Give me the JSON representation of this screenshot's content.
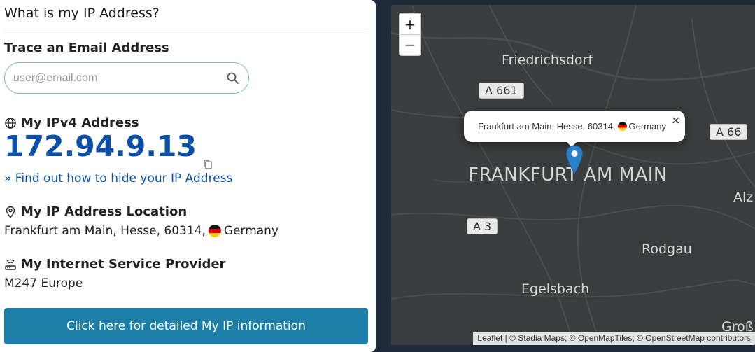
{
  "page": {
    "title": "What is my IP Address?"
  },
  "trace": {
    "heading": "Trace an Email Address",
    "placeholder": "user@email.com",
    "icon": "search-icon"
  },
  "ipv4": {
    "heading": "My IPv4 Address",
    "value": "172.94.9.13",
    "icon": "globe-icon",
    "hide_link": "» Find out how to hide your IP Address"
  },
  "location": {
    "heading": "My IP Address Location",
    "text": "Frankfurt am Main, Hesse, 60314,",
    "country": "Germany",
    "icon": "location-pin-icon"
  },
  "isp": {
    "heading": "My Internet Service Provider",
    "value": "M247 Europe",
    "icon": "router-icon"
  },
  "detail_button": {
    "label": "Click here for detailed My IP information"
  },
  "map": {
    "zoom_in": "+",
    "zoom_out": "−",
    "labels": {
      "friedrichsdorf": "Friedrichsdorf",
      "frankfurt": "FRANKFURT AM MAIN",
      "rodgau": "Rodgau",
      "egelsbach": "Egelsbach",
      "alz": "Alz",
      "gross": "Groß"
    },
    "shields": {
      "a661": "A 661",
      "a66": "A 66",
      "a3": "A 3"
    },
    "popup": {
      "text": "Frankfurt am Main, Hesse, 60314,",
      "country": "Germany",
      "close": "×"
    },
    "attribution": "Leaflet | © Stadia Maps; © OpenMapTiles; © OpenStreetMap contributors"
  },
  "colors": {
    "accent": "#0b4fa8",
    "button": "#1d7fa8",
    "map_bg": "#3b3f3f"
  }
}
